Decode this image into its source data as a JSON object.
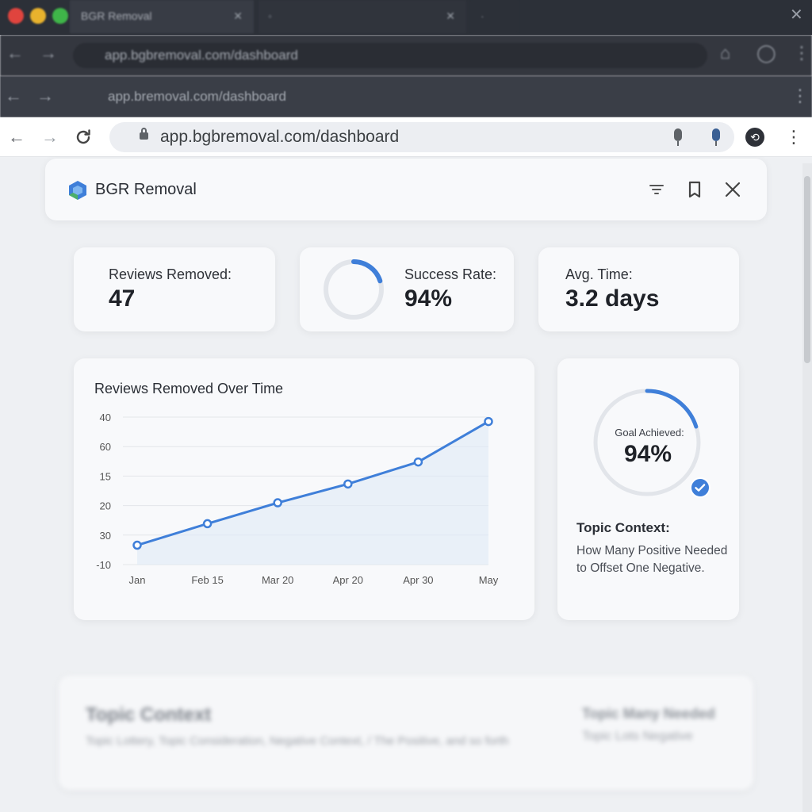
{
  "colors": {
    "accent": "#3f7fd9",
    "card": "#f8f9fb",
    "background": "#eef0f3"
  },
  "browser": {
    "tab1_title": "BGR Removal",
    "back_url": "app.bgbremoval.com/dashboard",
    "back_url2": "app.bremoval.com/dashboard",
    "url": "app.bgbremoval.com/dashboard"
  },
  "app": {
    "title": "BGR Removal"
  },
  "stats": [
    {
      "label": "Reviews Removed:",
      "value": "47"
    },
    {
      "label": "Success Rate:",
      "value": "94%",
      "ring_fraction": 0.2
    },
    {
      "label": "Avg. Time:",
      "value": "3.2 days"
    }
  ],
  "chart": {
    "title": "Reviews Removed Over Time"
  },
  "chart_data": {
    "type": "line",
    "title": "Reviews Removed Over Time",
    "y_tick_labels": [
      "40",
      "60",
      "15",
      "20",
      "30",
      "-10"
    ],
    "x_tick_labels": [
      "Jan",
      "Feb 15",
      "Mar 20",
      "Apr 20",
      "Apr 30",
      "May"
    ],
    "x": [
      "Jan",
      "Feb 15",
      "Mar 20",
      "Apr 20",
      "Apr 30",
      "May"
    ],
    "values": [
      5.8,
      23.3,
      40.3,
      55.6,
      73.5,
      106.4
    ],
    "series_color": "#3f7fd9",
    "area_fill": true,
    "grid": true,
    "ylim": [
      -10,
      110
    ]
  },
  "goal": {
    "label": "Goal Achieved:",
    "value": "94%",
    "ring_fraction": 0.2,
    "topic_title": "Topic Context:",
    "topic_text": "How Many Positive Needed to Offset One Negative."
  },
  "footer_blurred": {
    "title": "Topic Context",
    "line": "Topic Lottery, Topic Consideration, Negative Context, / The Positive, and so forth",
    "right_title": "Topic Many Needed",
    "right_line": "Topic Lots Negative"
  }
}
